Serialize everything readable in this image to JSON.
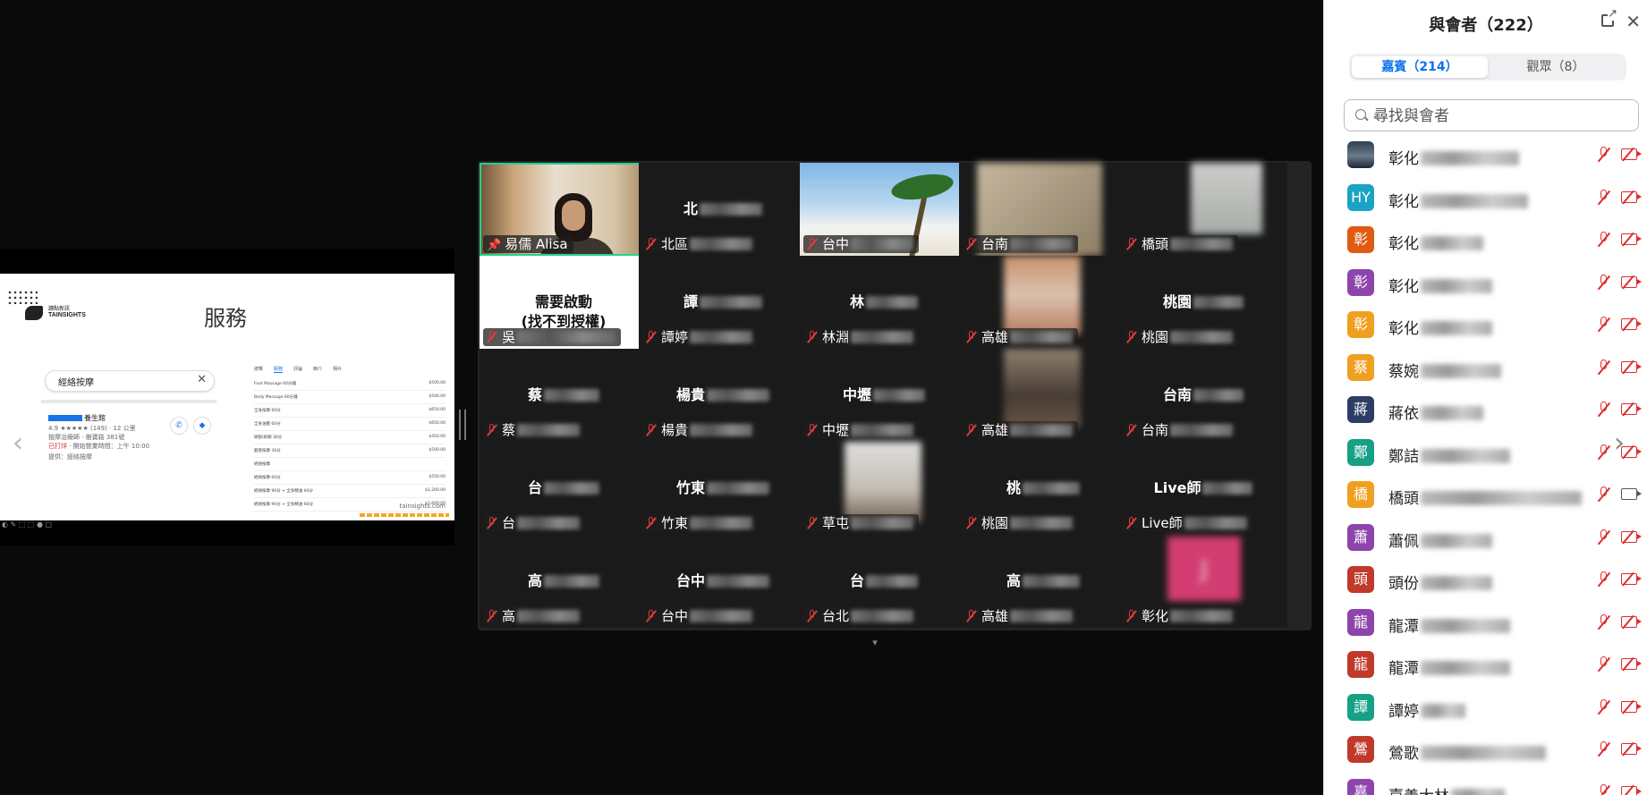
{
  "slide": {
    "logo_zh": "讀點新訊",
    "logo_en": "TAINSIGHTS",
    "title": "服務",
    "map_search": "經絡按摩",
    "biz_name": "養生館",
    "biz_rating": "4.9 ★★★★★ (149) · 12 公里",
    "biz_type": "按摩治療師 · 樹寶路 381號",
    "biz_open": "已打烊",
    "biz_hours": " · 開始營業時間：上午 10:00",
    "biz_tag": "提供：經絡按摩",
    "tabs": [
      "總覽",
      "服務",
      "評論",
      "簡介",
      "相片"
    ],
    "prices": [
      {
        "name": "Foot Massage 60分鐘",
        "price": "$500.00"
      },
      {
        "name": "Body Massage 60分鐘",
        "price": "$500.00"
      },
      {
        "name": "全身按摩 60分",
        "price": "$650.00"
      },
      {
        "name": "全身油壓 60分",
        "price": "$650.00"
      },
      {
        "name": "頭部/肩頸 30分",
        "price": "$450.00"
      },
      {
        "name": "腳底按摩 30分",
        "price": "$500.00"
      },
      {
        "name": "經絡按摩",
        "price": ""
      },
      {
        "name": "經絡按摩 60分",
        "price": "$550.00"
      },
      {
        "name": "經絡按摩 90分 + 全身精油 60分",
        "price": "$1,200.00"
      },
      {
        "name": "經絡按摩 90分 + 全身精油 60分",
        "price": "$1,600.00"
      }
    ],
    "url": "tainsights.com"
  },
  "grid": {
    "tiles": [
      {
        "tag": "易儒 Alisa",
        "center": "",
        "pinned": true
      },
      {
        "tag": "北區",
        "center": "北",
        "pinned": false
      },
      {
        "tag": "台中",
        "center": "",
        "pinned": false
      },
      {
        "tag": "台南",
        "center": "",
        "pinned": false
      },
      {
        "tag": "橋頭",
        "center": "",
        "pinned": false
      },
      {
        "tag": "吳",
        "center": "",
        "pinned": false
      },
      {
        "tag": "譚婷",
        "center": "譚",
        "pinned": false
      },
      {
        "tag": "林淵",
        "center": "林",
        "pinned": false
      },
      {
        "tag": "高雄",
        "center": "",
        "pinned": false
      },
      {
        "tag": "桃園",
        "center": "桃園",
        "pinned": false
      },
      {
        "tag": "蔡",
        "center": "蔡",
        "pinned": false
      },
      {
        "tag": "楊貴",
        "center": "楊貴",
        "pinned": false
      },
      {
        "tag": "中壢",
        "center": "中壢",
        "pinned": false
      },
      {
        "tag": "高雄",
        "center": "",
        "pinned": false
      },
      {
        "tag": "台南",
        "center": "台南",
        "pinned": false
      },
      {
        "tag": "台",
        "center": "台",
        "pinned": false
      },
      {
        "tag": "竹東",
        "center": "竹東",
        "pinned": false
      },
      {
        "tag": "草屯",
        "center": "",
        "pinned": false
      },
      {
        "tag": "桃園",
        "center": "桃",
        "pinned": false
      },
      {
        "tag": "Live師",
        "center": "Live師",
        "pinned": false
      },
      {
        "tag": "高",
        "center": "高",
        "pinned": false
      },
      {
        "tag": "台中",
        "center": "台中",
        "pinned": false
      },
      {
        "tag": "台北",
        "center": "台",
        "pinned": false
      },
      {
        "tag": "高雄",
        "center": "高",
        "pinned": false
      },
      {
        "tag": "彰化",
        "center": "",
        "pinned": false
      }
    ],
    "promo_line1": "需要啟動",
    "promo_line2": "(找不到授權)",
    "pink_initial": "J"
  },
  "panel": {
    "title": "與會者（222）",
    "tab_panelists": "嘉賓（214）",
    "tab_attendees": "觀眾（8）",
    "search_placeholder": "尋找與會者",
    "participants": [
      {
        "avatar": "",
        "avatar_color": "photo",
        "name": "彰化",
        "cam": "off"
      },
      {
        "avatar": "HY",
        "avatar_color": "#1aa3c4",
        "name": "彰化",
        "cam": "off"
      },
      {
        "avatar": "彰",
        "avatar_color": "#e05a12",
        "name": "彰化",
        "cam": "off"
      },
      {
        "avatar": "彰",
        "avatar_color": "#8e44ad",
        "name": "彰化",
        "cam": "off"
      },
      {
        "avatar": "彰",
        "avatar_color": "#f0a020",
        "name": "彰化",
        "cam": "off"
      },
      {
        "avatar": "蔡",
        "avatar_color": "#f0a020",
        "name": "蔡婉",
        "cam": "off"
      },
      {
        "avatar": "蔣",
        "avatar_color": "#2c3e66",
        "name": "蔣依",
        "cam": "off"
      },
      {
        "avatar": "鄭",
        "avatar_color": "#16a085",
        "name": "鄭詰",
        "cam": "off"
      },
      {
        "avatar": "橋",
        "avatar_color": "#f0a020",
        "name": "橋頭",
        "cam": "on"
      },
      {
        "avatar": "蕭",
        "avatar_color": "#8e44ad",
        "name": "蕭佩",
        "cam": "off"
      },
      {
        "avatar": "頭",
        "avatar_color": "#c0392b",
        "name": "頭份",
        "cam": "off"
      },
      {
        "avatar": "龍",
        "avatar_color": "#8e44ad",
        "name": "龍潭",
        "cam": "off"
      },
      {
        "avatar": "龍",
        "avatar_color": "#c0392b",
        "name": "龍潭",
        "cam": "off"
      },
      {
        "avatar": "譚",
        "avatar_color": "#16a085",
        "name": "譚婷",
        "cam": "off"
      },
      {
        "avatar": "鶯",
        "avatar_color": "#c0392b",
        "name": "鶯歌",
        "cam": "off"
      },
      {
        "avatar": "嘉",
        "avatar_color": "#8e44ad",
        "name": "嘉義大林",
        "cam": "off"
      }
    ]
  }
}
